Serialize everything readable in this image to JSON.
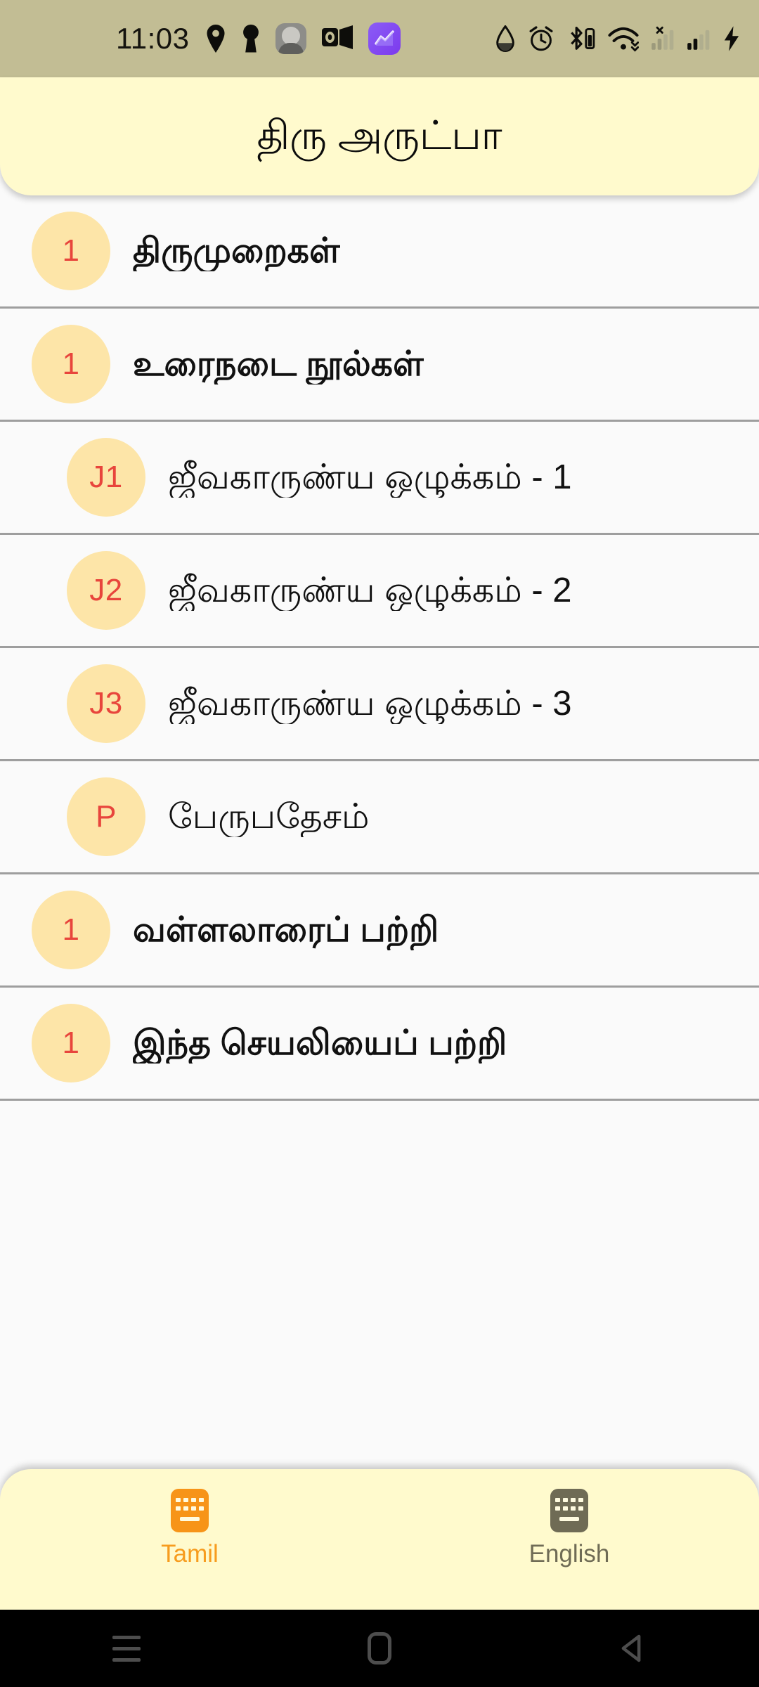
{
  "statusbar": {
    "time": "11:03",
    "left_icons": [
      "location-pin-icon",
      "keyhole-vpn-icon",
      "profile-avatar-icon",
      "outlook-icon",
      "chart-app-icon"
    ],
    "right_icons": [
      "water-drop-icon",
      "alarm-clock-icon",
      "bluetooth-battery-icon",
      "wifi-icon",
      "signal-no-service-icon",
      "signal-bars-icon",
      "charging-bolt-icon"
    ],
    "background": "#C2BD94"
  },
  "header": {
    "title": "திரு அருட்பா",
    "background": "#FFFACD"
  },
  "list": {
    "items": [
      {
        "badge": "1",
        "label": "திருமுறைகள்",
        "level": "parent"
      },
      {
        "badge": "1",
        "label": "உரைநடை நூல்கள்",
        "level": "parent"
      },
      {
        "badge": "J1",
        "label": "ஜீவகாருண்ய ஒழுக்கம் - 1",
        "level": "child"
      },
      {
        "badge": "J2",
        "label": "ஜீவகாருண்ய ஒழுக்கம் - 2",
        "level": "child"
      },
      {
        "badge": "J3",
        "label": "ஜீவகாருண்ய ஒழுக்கம் - 3",
        "level": "child"
      },
      {
        "badge": "P",
        "label": "பேருபதேசம்",
        "level": "child"
      },
      {
        "badge": "1",
        "label": "வள்ளலாரைப் பற்றி",
        "level": "parent"
      },
      {
        "badge": "1",
        "label": "இந்த செயலியைப் பற்றி",
        "level": "parent"
      }
    ],
    "badge_background": "#FDE5A8",
    "badge_color": "#E8453C",
    "divider_color": "#9E9E9E",
    "background": "#FAFAFA"
  },
  "bottom_nav": {
    "items": [
      {
        "label": "Tamil",
        "icon": "keyboard-icon",
        "state": "active"
      },
      {
        "label": "English",
        "icon": "keyboard-icon",
        "state": "inactive"
      }
    ],
    "active_color": "#F79C1E",
    "inactive_color": "#6F6B55",
    "background": "#FFFACD"
  },
  "system_nav": {
    "buttons": [
      "recents-icon",
      "home-icon",
      "back-icon"
    ]
  }
}
